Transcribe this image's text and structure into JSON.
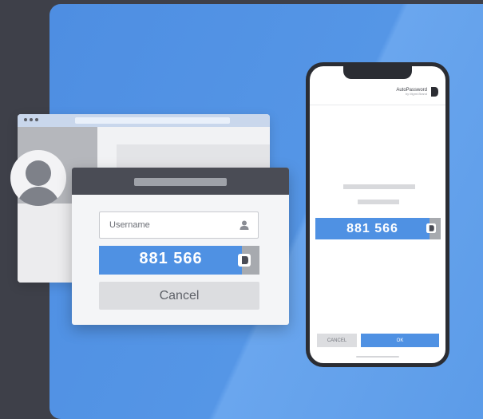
{
  "dialog": {
    "username_placeholder": "Username",
    "code": "881 566",
    "cancel_label": "Cancel"
  },
  "phone": {
    "app_name": "AutoPassword",
    "app_subtitle": "by Mgmt.Brand",
    "code": "881 566",
    "cancel_label": "CANCEL",
    "ok_label": "OK"
  },
  "icons": {
    "user": "user-icon",
    "badge": "autopassword-badge-icon",
    "logo": "autopassword-logo-icon"
  },
  "colors": {
    "background": "#3e4049",
    "panel": "#5596e6",
    "accent": "#4f91e3",
    "dialog_header": "#4a4c55"
  }
}
